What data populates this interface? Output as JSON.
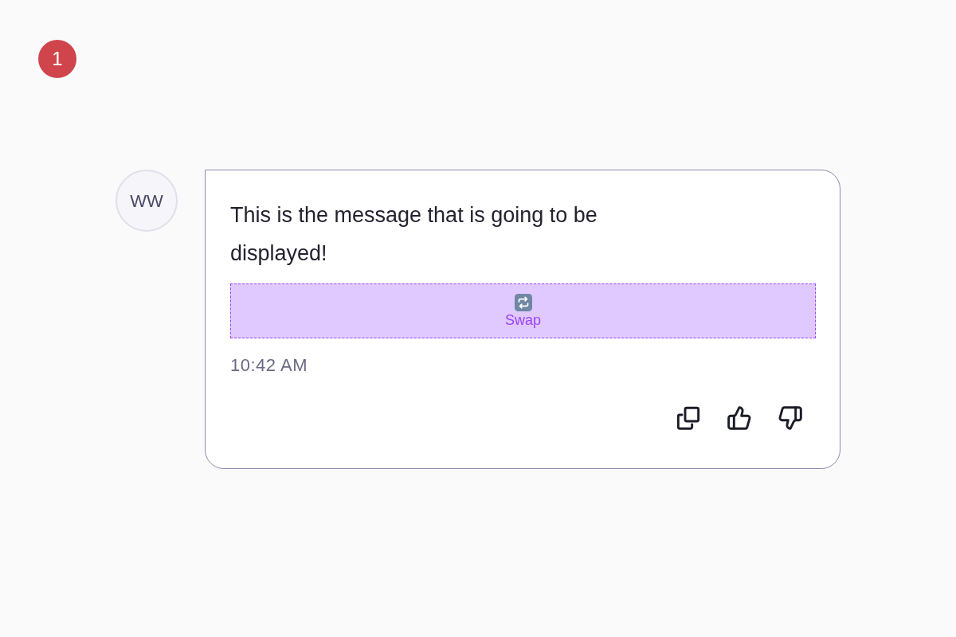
{
  "badge": {
    "text": "1"
  },
  "message": {
    "avatar": {
      "initials": "WW"
    },
    "text": "This is the message that is going to be displayed!",
    "swap": {
      "label": "Swap"
    },
    "time": "10:42 AM"
  }
}
